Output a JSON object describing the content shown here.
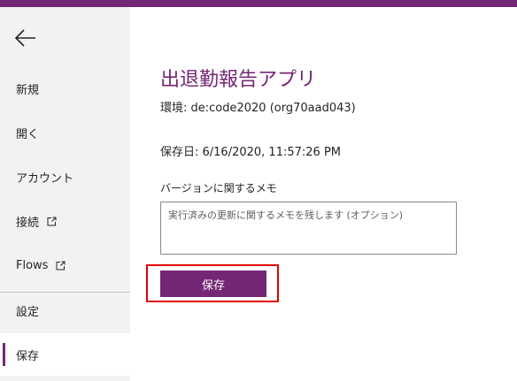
{
  "sidebar": {
    "back_icon": "arrow-left-icon",
    "items": [
      {
        "label": "新規"
      },
      {
        "label": "開く"
      },
      {
        "label": "アカウント"
      },
      {
        "label": "接続",
        "icon": "external-link-icon"
      },
      {
        "label": "Flows",
        "icon": "external-link-icon"
      },
      {
        "label": "設定"
      },
      {
        "label": "保存",
        "active": true
      }
    ]
  },
  "main": {
    "title": "出退勤報告アプリ",
    "environment": "環境: de:code2020 (org70aad043)",
    "saved_date": "保存日: 6/16/2020, 11:57:26 PM",
    "memo_label": "バージョンに関するメモ",
    "memo_placeholder": "実行済みの更新に関するメモを残します (オプション)",
    "save_label": "保存"
  },
  "colors": {
    "brand": "#742774",
    "sidebar_bg": "#f3f2f1",
    "highlight": "#e00000"
  }
}
